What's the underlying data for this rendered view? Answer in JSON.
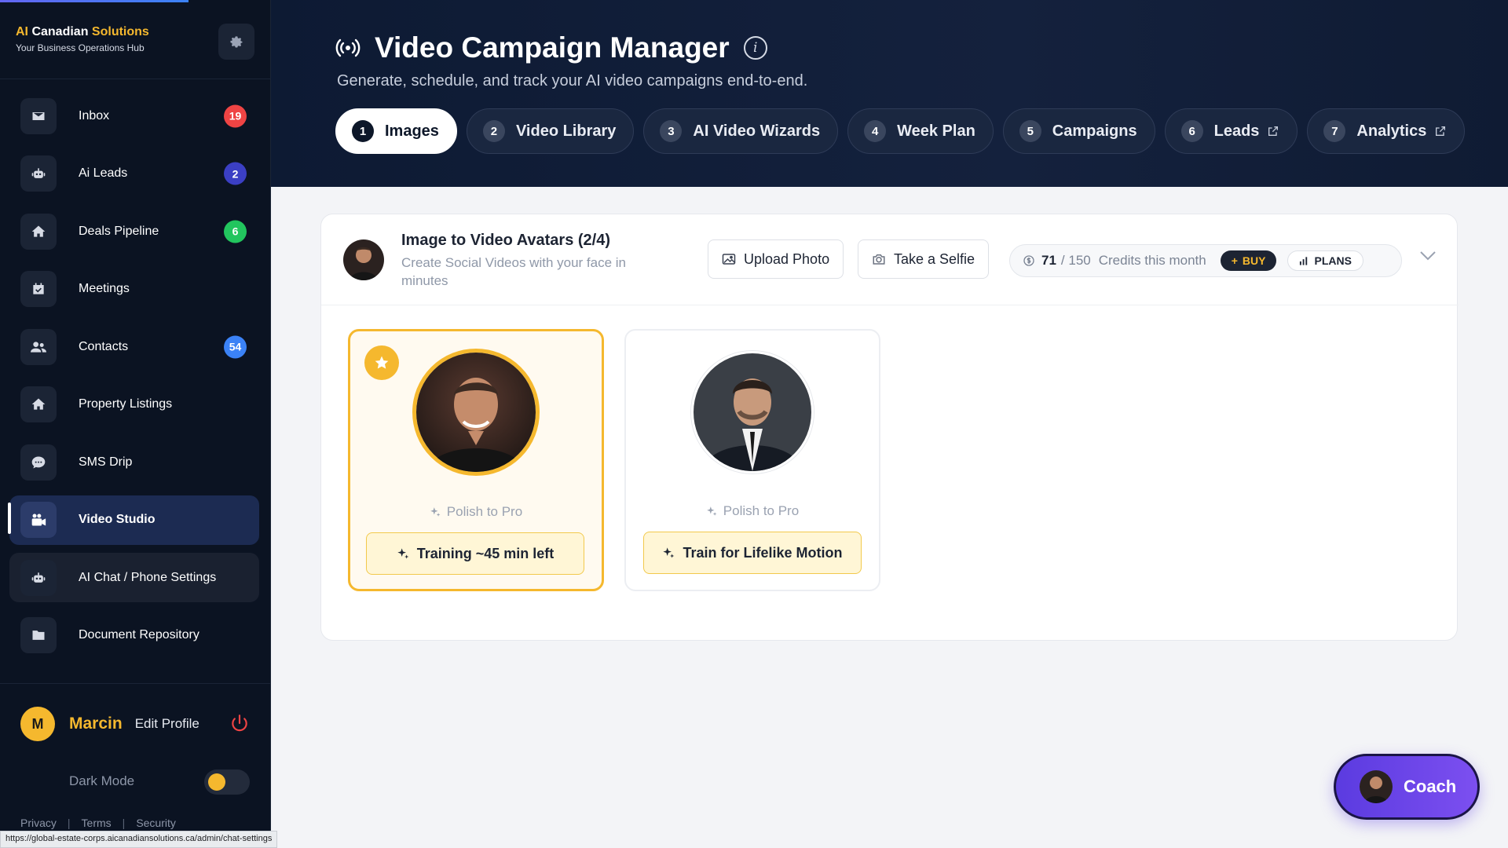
{
  "sidebar": {
    "brand_ai": "AI",
    "brand_mid": "Canadian",
    "brand_end": "Solutions",
    "brand_sub": "Your Business Operations Hub",
    "items": [
      {
        "label": "Inbox",
        "badge": "19",
        "badge_color": "#ef4444",
        "icon": "envelope-icon"
      },
      {
        "label": "Ai Leads",
        "badge": "2",
        "badge_color": "#3b3fc4",
        "icon": "robot-icon"
      },
      {
        "label": "Deals Pipeline",
        "badge": "6",
        "badge_color": "#22c55e",
        "icon": "home-icon"
      },
      {
        "label": "Meetings",
        "badge": "",
        "icon": "calendar-icon"
      },
      {
        "label": "Contacts",
        "badge": "54",
        "badge_color": "#3b82f6",
        "icon": "users-icon"
      },
      {
        "label": "Property Listings",
        "badge": "",
        "icon": "home-icon"
      },
      {
        "label": "SMS Drip",
        "badge": "",
        "icon": "chat-icon"
      },
      {
        "label": "Video Studio",
        "badge": "",
        "icon": "video-icon"
      },
      {
        "label": "AI Chat / Phone Settings",
        "badge": "",
        "icon": "robot-icon"
      },
      {
        "label": "Document Repository",
        "badge": "",
        "icon": "folder-icon"
      }
    ],
    "profile": {
      "initial": "M",
      "name": "Marcin",
      "edit": "Edit Profile"
    },
    "dark_mode": "Dark Mode",
    "legal": [
      "Privacy",
      "Terms",
      "Security"
    ]
  },
  "statusbar": "https://global-estate-corps.aicanadiansolutions.ca/admin/chat-settings",
  "header": {
    "title": "Video Campaign Manager",
    "subtitle": "Generate, schedule, and track your AI video campaigns end-to-end.",
    "tabs": [
      {
        "num": "1",
        "label": "Images",
        "external": false
      },
      {
        "num": "2",
        "label": "Video Library",
        "external": false
      },
      {
        "num": "3",
        "label": "AI Video Wizards",
        "external": false
      },
      {
        "num": "4",
        "label": "Week Plan",
        "external": false
      },
      {
        "num": "5",
        "label": "Campaigns",
        "external": false
      },
      {
        "num": "6",
        "label": "Leads",
        "external": true
      },
      {
        "num": "7",
        "label": "Analytics",
        "external": true
      }
    ]
  },
  "card": {
    "title": "Image to Video Avatars (2/4)",
    "subtitle": "Create Social Videos with your face in minutes",
    "upload": "Upload Photo",
    "selfie": "Take a Selfie",
    "credits_used": "71",
    "credits_total": "/ 150",
    "credits_label": "Credits this month",
    "buy": "BUY",
    "plans": "PLANS",
    "avatars": [
      {
        "polish": "Polish to Pro",
        "action": "Training ~45 min left"
      },
      {
        "polish": "Polish to Pro",
        "action": "Train for Lifelike Motion"
      }
    ]
  },
  "coach": "Coach"
}
